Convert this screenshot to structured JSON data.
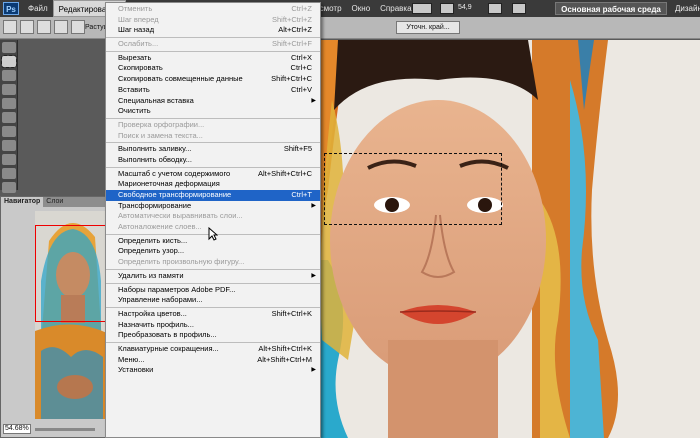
{
  "menubar": {
    "logo": "Ps",
    "items": [
      "Файл",
      "Редактирование"
    ],
    "active_index": 1,
    "right_items": [
      "Просмотр",
      "Окно",
      "Справка"
    ],
    "zoom_value": "54,9",
    "workspace": "Основная рабочая среда",
    "design": "Дизайн"
  },
  "options": {
    "feather_label": "Растуше",
    "refine_edge": "Уточн. край..."
  },
  "navigator": {
    "tabs": [
      "Навигатор",
      "Слои"
    ],
    "zoom": "54.68%"
  },
  "edit_menu": {
    "sections": [
      [
        {
          "label": "Отменить",
          "shortcut": "Ctrl+Z",
          "disabled": true
        },
        {
          "label": "Шаг вперед",
          "shortcut": "Shift+Ctrl+Z",
          "disabled": true
        },
        {
          "label": "Шаг назад",
          "shortcut": "Alt+Ctrl+Z",
          "disabled": false
        }
      ],
      [
        {
          "label": "Ослабить...",
          "shortcut": "Shift+Ctrl+F",
          "disabled": true
        }
      ],
      [
        {
          "label": "Вырезать",
          "shortcut": "Ctrl+X",
          "disabled": false
        },
        {
          "label": "Скопировать",
          "shortcut": "Ctrl+C",
          "disabled": false
        },
        {
          "label": "Скопировать совмещенные данные",
          "shortcut": "Shift+Ctrl+C",
          "disabled": false
        },
        {
          "label": "Вставить",
          "shortcut": "Ctrl+V",
          "disabled": false
        },
        {
          "label": "Специальная вставка",
          "shortcut": "",
          "submenu": true,
          "disabled": false
        },
        {
          "label": "Очистить",
          "shortcut": "",
          "disabled": false
        }
      ],
      [
        {
          "label": "Проверка орфографии...",
          "shortcut": "",
          "disabled": true
        },
        {
          "label": "Поиск и замена текста...",
          "shortcut": "",
          "disabled": true
        }
      ],
      [
        {
          "label": "Выполнить заливку...",
          "shortcut": "Shift+F5",
          "disabled": false
        },
        {
          "label": "Выполнить обводку...",
          "shortcut": "",
          "disabled": false
        }
      ],
      [
        {
          "label": "Масштаб с учетом содержимого",
          "shortcut": "Alt+Shift+Ctrl+C",
          "disabled": false
        },
        {
          "label": "Марионеточная деформация",
          "shortcut": "",
          "disabled": false
        },
        {
          "label": "Свободное трансформирование",
          "shortcut": "Ctrl+T",
          "disabled": false,
          "highlight": true
        },
        {
          "label": "Трансформирование",
          "shortcut": "",
          "submenu": true,
          "disabled": false
        },
        {
          "label": "Автоматически выравнивать слои...",
          "shortcut": "",
          "disabled": true
        },
        {
          "label": "Автоналожение слоев...",
          "shortcut": "",
          "disabled": true
        }
      ],
      [
        {
          "label": "Определить кисть...",
          "shortcut": "",
          "disabled": false
        },
        {
          "label": "Определить узор...",
          "shortcut": "",
          "disabled": false
        },
        {
          "label": "Определить произвольную фигуру...",
          "shortcut": "",
          "disabled": true
        }
      ],
      [
        {
          "label": "Удалить из памяти",
          "shortcut": "",
          "submenu": true,
          "disabled": false
        }
      ],
      [
        {
          "label": "Наборы параметров Adobe PDF...",
          "shortcut": "",
          "disabled": false
        },
        {
          "label": "Управление наборами...",
          "shortcut": "",
          "disabled": false
        }
      ],
      [
        {
          "label": "Настройка цветов...",
          "shortcut": "Shift+Ctrl+K",
          "disabled": false
        },
        {
          "label": "Назначить профиль...",
          "shortcut": "",
          "disabled": false
        },
        {
          "label": "Преобразовать в профиль...",
          "shortcut": "",
          "disabled": false
        }
      ],
      [
        {
          "label": "Клавиатурные сокращения...",
          "shortcut": "Alt+Shift+Ctrl+K",
          "disabled": false
        },
        {
          "label": "Меню...",
          "shortcut": "Alt+Shift+Ctrl+M",
          "disabled": false
        },
        {
          "label": "Установки",
          "shortcut": "",
          "submenu": true,
          "disabled": false
        }
      ]
    ]
  }
}
